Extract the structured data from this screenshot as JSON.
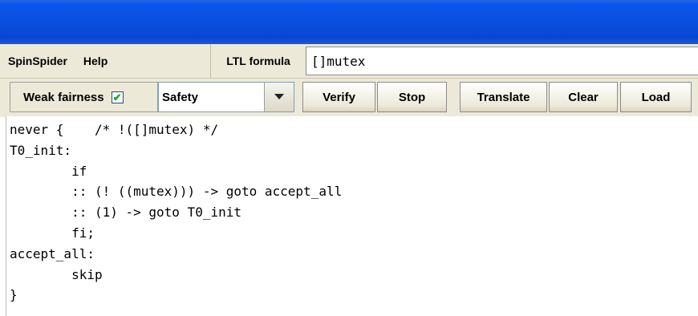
{
  "menu": {
    "items": [
      "SpinSpider",
      "Help"
    ]
  },
  "ltl": {
    "label": "LTL formula",
    "value": "[]mutex"
  },
  "toolbar": {
    "weak_fairness_label": "Weak fairness",
    "weak_fairness_checked": "✔",
    "mode_value": "Safety",
    "buttons": {
      "verify": "Verify",
      "stop": "Stop",
      "translate": "Translate",
      "clear": "Clear",
      "load": "Load"
    }
  },
  "editor": {
    "text": "never {    /* !([]mutex) */\nT0_init:\n        if\n        :: (! ((mutex))) -> goto accept_all\n        :: (1) -> goto T0_init\n        fi;\naccept_all:\n        skip\n}"
  },
  "colors": {
    "titlebar": "#0a50e0",
    "panel": "#ece9d8",
    "check": "#21a121"
  }
}
